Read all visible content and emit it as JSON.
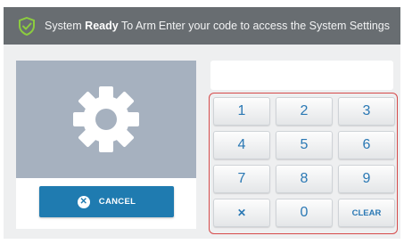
{
  "header": {
    "status_prefix": "System",
    "status_strong": "Ready",
    "status_suffix": "To Arm",
    "prompt": "Enter your code to access the System Settings",
    "icon": "shield-check-icon"
  },
  "settings_panel": {
    "icon": "gear-icon",
    "cancel_label": "CANCEL",
    "cancel_icon": "close-circle-icon"
  },
  "code_display": {
    "value": ""
  },
  "keypad": {
    "keys": [
      "1",
      "2",
      "3",
      "4",
      "5",
      "6",
      "7",
      "8",
      "9",
      "✕",
      "0",
      "CLEAR"
    ]
  },
  "colors": {
    "header_bg": "#686d71",
    "panel_bg": "#eeeff0",
    "settings_image_bg": "#a6b1bf",
    "accent_blue": "#1f7bb0",
    "keypad_border": "#d64a4a",
    "shield_green": "#8ccc3f"
  }
}
